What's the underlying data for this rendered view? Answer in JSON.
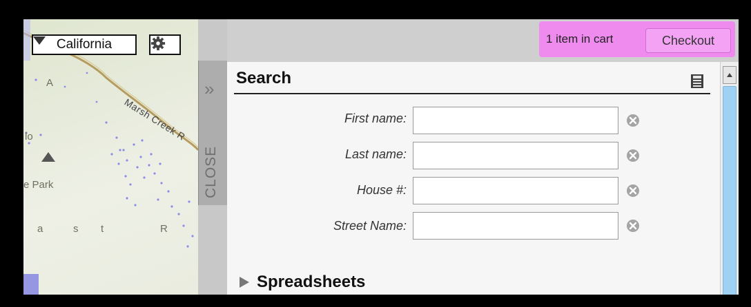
{
  "map": {
    "state_selected": "California",
    "labels": {
      "creek": "Marsh Creek R",
      "a1": "A",
      "lo": "lo",
      "park": "e Park",
      "a2": "a",
      "s": "s",
      "t": "t",
      "r": "R"
    }
  },
  "side_tab": {
    "label": "CLOSE",
    "arrow": "»"
  },
  "cart": {
    "text": "1 item in cart",
    "checkout_label": "Checkout"
  },
  "search": {
    "title": "Search",
    "fields": [
      {
        "label": "First name:",
        "value": ""
      },
      {
        "label": "Last name:",
        "value": ""
      },
      {
        "label": "House #:",
        "value": ""
      },
      {
        "label": "Street Name:",
        "value": ""
      }
    ]
  },
  "sections": {
    "spreadsheets": "Spreadsheets"
  },
  "colors": {
    "cart_bg": "#ef8bef",
    "scroll_thumb": "#9ed1f4",
    "heading": "#111111"
  }
}
